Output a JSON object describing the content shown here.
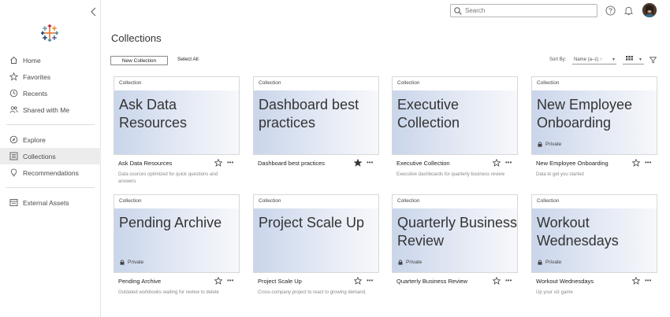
{
  "header": {
    "search_placeholder": "Search",
    "icons": [
      "help-icon",
      "bell-icon",
      "user-avatar"
    ]
  },
  "sidebar": {
    "items": [
      {
        "label": "Home",
        "icon": "home-icon"
      },
      {
        "label": "Favorites",
        "icon": "star-icon"
      },
      {
        "label": "Recents",
        "icon": "clock-icon"
      },
      {
        "label": "Shared with Me",
        "icon": "shared-icon"
      },
      {
        "label": "Explore",
        "icon": "compass-icon"
      },
      {
        "label": "Collections",
        "icon": "collections-icon",
        "active": true
      },
      {
        "label": "Recommendations",
        "icon": "lightbulb-icon"
      },
      {
        "label": "External Assets",
        "icon": "external-assets-icon"
      }
    ]
  },
  "page": {
    "title": "Collections"
  },
  "toolbar": {
    "new_collection": "New Collection",
    "select_all": "Select All",
    "sort_label": "Sort By:",
    "sort_value": "Name (a–z) ↑"
  },
  "cards": [
    {
      "tag": "Collection",
      "title": "Ask Data Resources",
      "name": "Ask Data Resources",
      "desc": "Data sources optimized for quick questions and answers",
      "private": "",
      "favorited": false
    },
    {
      "tag": "Collection",
      "title": "Dashboard best practices",
      "name": "Dashboard best practices",
      "desc": "",
      "private": "",
      "favorited": true
    },
    {
      "tag": "Collection",
      "title": "Executive Collection",
      "name": "Executive Collection",
      "desc": "Executive dashboards for quarterly business review",
      "private": "",
      "favorited": false
    },
    {
      "tag": "Collection",
      "title": "New Employee Onboarding",
      "name": "New Employee Onboarding",
      "desc": "Data to get you started",
      "private": "Private",
      "favorited": false
    },
    {
      "tag": "Collection",
      "title": "Pending Archive",
      "name": "Pending Archive",
      "desc": "Outdated workbooks waiting for review to delete",
      "private": "Private",
      "favorited": false
    },
    {
      "tag": "Collection",
      "title": "Project Scale Up",
      "name": "Project Scale Up",
      "desc": "Cross-company project to react to growing demand.",
      "private": "",
      "favorited": false
    },
    {
      "tag": "Collection",
      "title": "Quarterly Business Review",
      "name": "Quarterly Business Review",
      "desc": "",
      "private": "Private",
      "favorited": false
    },
    {
      "tag": "Collection",
      "title": "Workout Wednesdays",
      "name": "Workout Wednesdays",
      "desc": "Up your viz game",
      "private": "Private",
      "favorited": false
    }
  ],
  "more_label": "•••",
  "colors": {
    "accent_blue": "#c9d5ea",
    "active_nav": "#ececec",
    "text": "#333333"
  }
}
